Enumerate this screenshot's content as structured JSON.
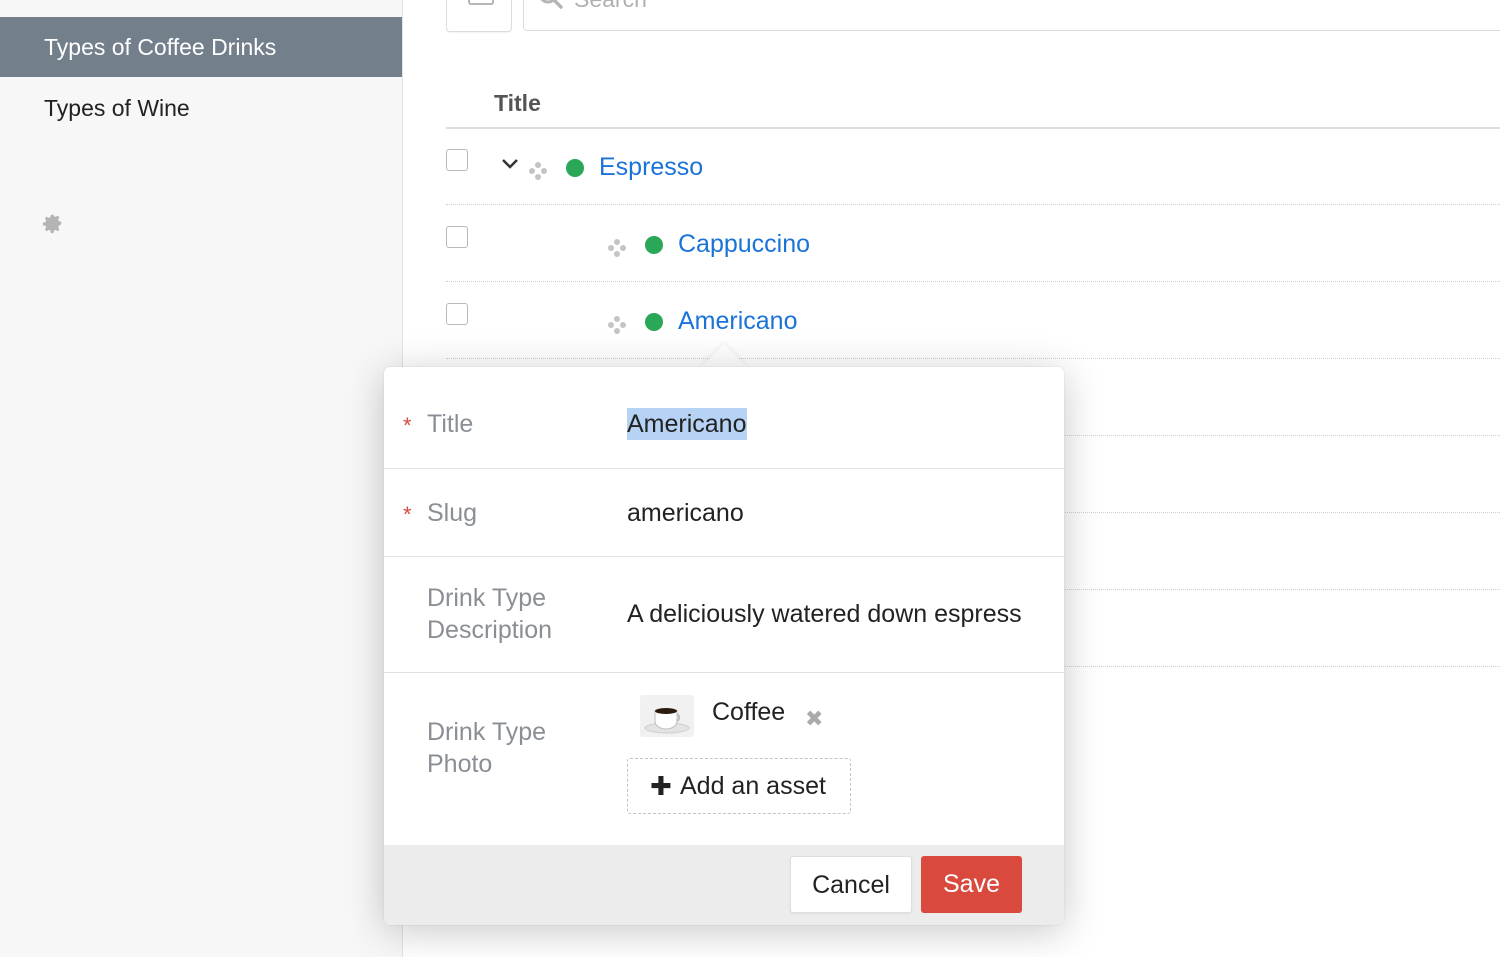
{
  "sidebar": {
    "items": [
      {
        "label": "Types of Coffee Drinks",
        "active": true
      },
      {
        "label": "Types of Wine",
        "active": false
      }
    ],
    "settings_icon": "gear-icon"
  },
  "search": {
    "placeholder": "Search"
  },
  "table": {
    "column_header": "Title",
    "rows": [
      {
        "title": "Espresso",
        "status": "published",
        "expanded": true,
        "level": 0
      },
      {
        "title": "Cappuccino",
        "status": "published",
        "level": 1
      },
      {
        "title": "Americano",
        "status": "published",
        "level": 1
      }
    ]
  },
  "editor": {
    "fields": {
      "title": {
        "label": "Title",
        "value": "Americano",
        "required": true
      },
      "slug": {
        "label": "Slug",
        "value": "americano",
        "required": true
      },
      "description": {
        "label_line1": "Drink Type",
        "label_line2": "Description",
        "value": "A deliciously watered down espresso"
      },
      "photo": {
        "label_line1": "Drink Type",
        "label_line2": "Photo",
        "asset_name": "Coffee",
        "add_label": "Add an asset"
      }
    },
    "cancel_label": "Cancel",
    "save_label": "Save"
  },
  "colors": {
    "sidebar_active": "#737f8b",
    "link": "#1a73d9",
    "status_published": "#2aa757",
    "save": "#d9493d",
    "required": "#d9493d"
  }
}
